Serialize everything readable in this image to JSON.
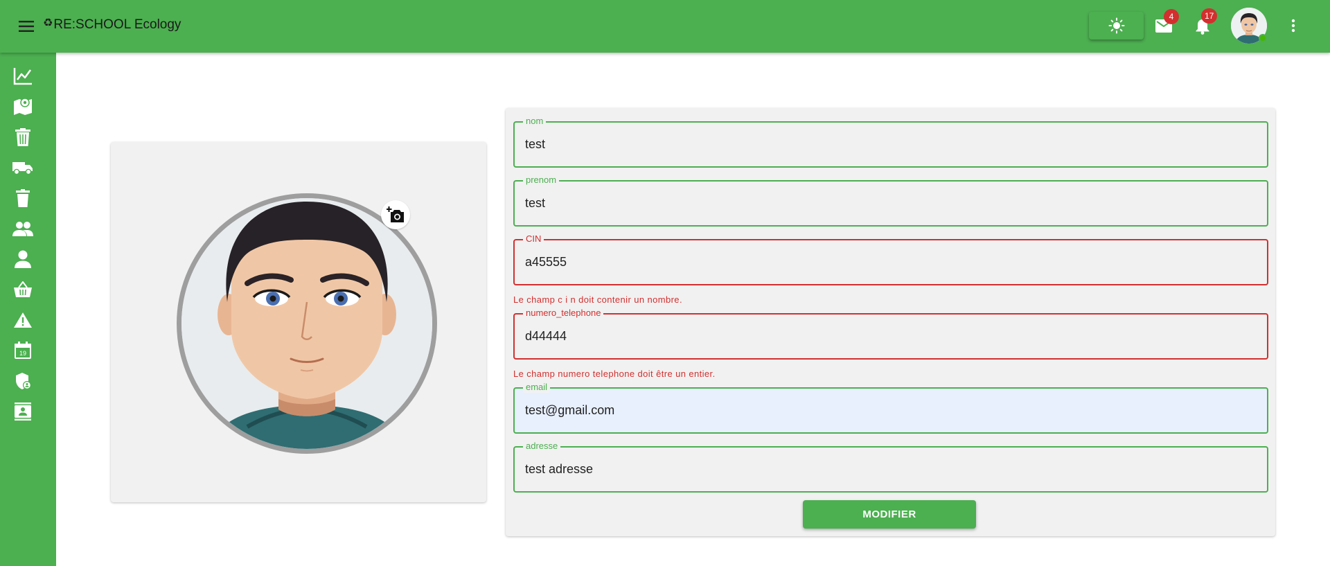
{
  "header": {
    "title": "RE:SCHOOL Ecology",
    "title_icon": "recycle-icon",
    "menu_icon": "hamburger-icon",
    "theme_icon": "sun-icon",
    "mail_count": "4",
    "notification_count": "17",
    "more_icon": "more-vert-icon",
    "user_status": "online"
  },
  "sidebar": {
    "items": [
      {
        "icon": "chart-icon"
      },
      {
        "icon": "map-icon"
      },
      {
        "icon": "trash-bin-icon"
      },
      {
        "icon": "truck-icon"
      },
      {
        "icon": "delete-icon"
      },
      {
        "icon": "group-icon"
      },
      {
        "icon": "person-icon"
      },
      {
        "icon": "basket-icon"
      },
      {
        "icon": "warning-icon"
      },
      {
        "icon": "calendar-icon",
        "text": "19"
      },
      {
        "icon": "admin-shield-icon"
      },
      {
        "icon": "contact-card-icon"
      }
    ]
  },
  "profile": {
    "camera_icon": "add-camera-icon"
  },
  "form": {
    "fields": [
      {
        "label": "nom",
        "value": "test",
        "state": "valid"
      },
      {
        "label": "prenom",
        "value": "test",
        "state": "valid"
      },
      {
        "label": "CIN",
        "value": "a45555",
        "state": "error",
        "error": "Le champ c i n doit contenir un nombre."
      },
      {
        "label": "numero_telephone",
        "value": "d44444",
        "state": "error",
        "error": "Le champ numero telephone doit être un entier."
      },
      {
        "label": "email",
        "value": "test@gmail.com",
        "state": "valid"
      },
      {
        "label": "adresse",
        "value": "test adresse",
        "state": "valid"
      }
    ],
    "submit_label": "MODIFIER"
  },
  "colors": {
    "primary": "#4caf50",
    "error": "#d32f2f",
    "badge": "#d32f2f",
    "card_bg": "#f1f1f1",
    "autofill_bg": "#e8f0fe"
  }
}
